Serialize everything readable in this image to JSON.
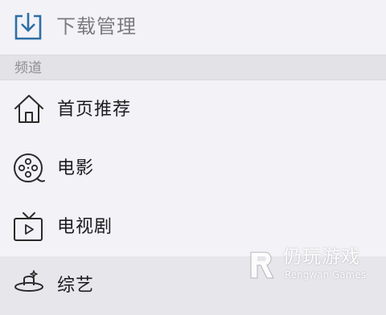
{
  "download": {
    "label": "下载管理",
    "icon": "download-icon"
  },
  "section": {
    "label": "频道"
  },
  "channels": [
    {
      "label": "首页推荐",
      "icon": "home-icon"
    },
    {
      "label": "电影",
      "icon": "film-reel-icon"
    },
    {
      "label": "电视剧",
      "icon": "tv-icon"
    },
    {
      "label": "综艺",
      "icon": "variety-hat-icon"
    }
  ],
  "watermark": {
    "name": "仍玩游戏",
    "subtitle": "Rengwan Games"
  },
  "colors": {
    "accent": "#2d6ea5",
    "background": "#f2f2f7",
    "section_bg": "#e2e2e7",
    "active_row": "#e6e6eb"
  }
}
